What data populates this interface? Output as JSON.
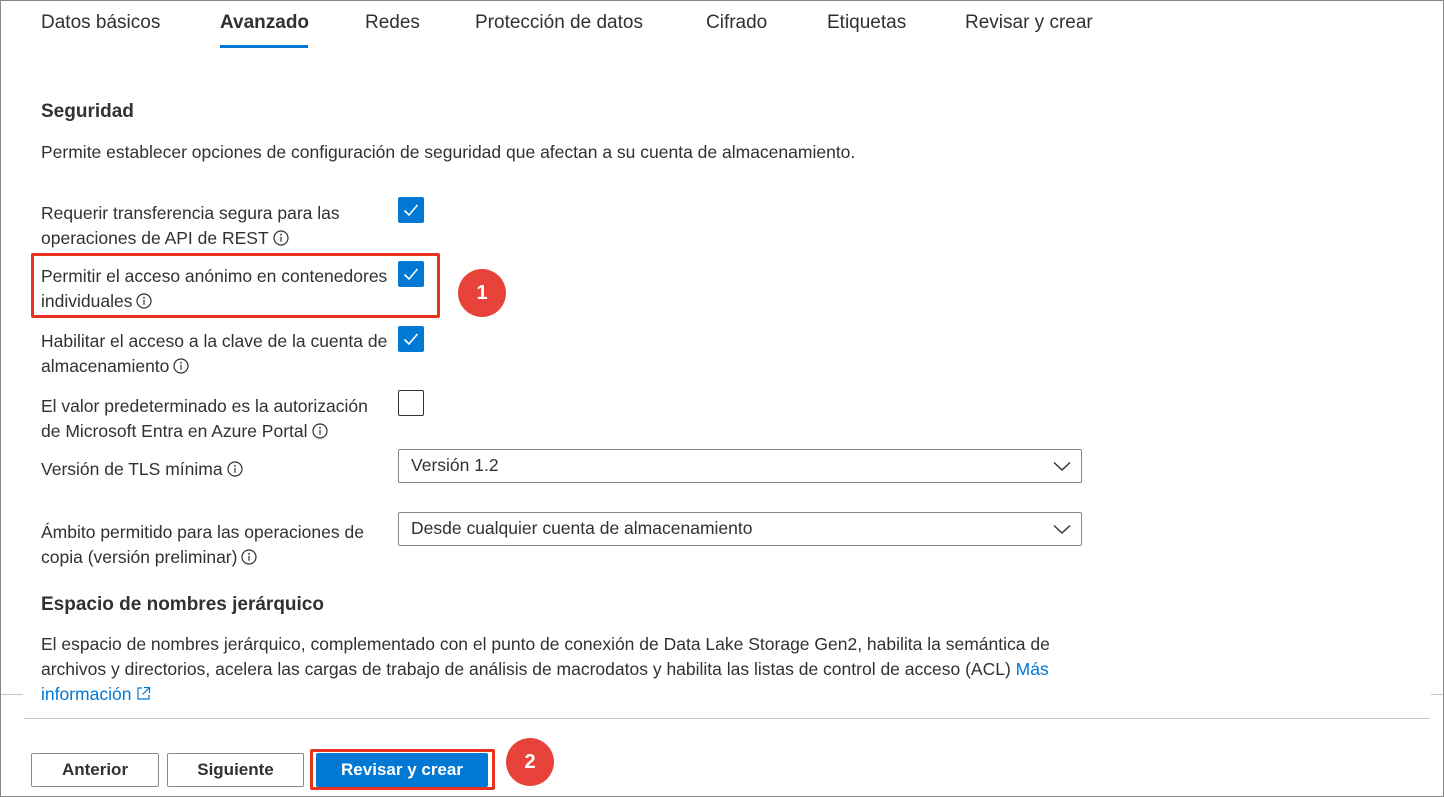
{
  "tabs": [
    {
      "label": "Datos básicos"
    },
    {
      "label": "Avanzado",
      "active": true
    },
    {
      "label": "Redes"
    },
    {
      "label": "Protección de datos"
    },
    {
      "label": "Cifrado"
    },
    {
      "label": "Etiquetas"
    },
    {
      "label": "Revisar y crear"
    }
  ],
  "security": {
    "heading": "Seguridad",
    "description": "Permite establecer opciones de configuración de seguridad que afectan a su cuenta de almacenamiento.",
    "options": [
      {
        "label": "Requerir transferencia segura para las operaciones de API de REST",
        "checked": true
      },
      {
        "label": "Permitir el acceso anónimo en contenedores individuales",
        "checked": true
      },
      {
        "label": "Habilitar el acceso a la clave de la cuenta de almacenamiento",
        "checked": true
      },
      {
        "label": "El valor predeterminado es la autorización de Microsoft Entra en Azure Portal",
        "checked": false
      }
    ],
    "tls": {
      "label": "Versión de TLS mínima",
      "value": "Versión 1.2"
    },
    "copy_scope": {
      "label": "Ámbito permitido para las operaciones de copia (versión preliminar)",
      "value": "Desde cualquier cuenta de almacenamiento"
    }
  },
  "hns": {
    "heading": "Espacio de nombres jerárquico",
    "description": "El espacio de nombres jerárquico, complementado con el punto de conexión de Data Lake Storage Gen2, habilita la semántica de archivos y directorios, acelera las cargas de trabajo de análisis de macrodatos y habilita las listas de control de acceso (ACL)",
    "link": "Más información"
  },
  "footer": {
    "previous": "Anterior",
    "next": "Siguiente",
    "review": "Revisar y crear"
  },
  "callouts": {
    "step1": "1",
    "step2": "2"
  },
  "colors": {
    "accent": "#0078d4",
    "callout_red": "#e8311e"
  }
}
